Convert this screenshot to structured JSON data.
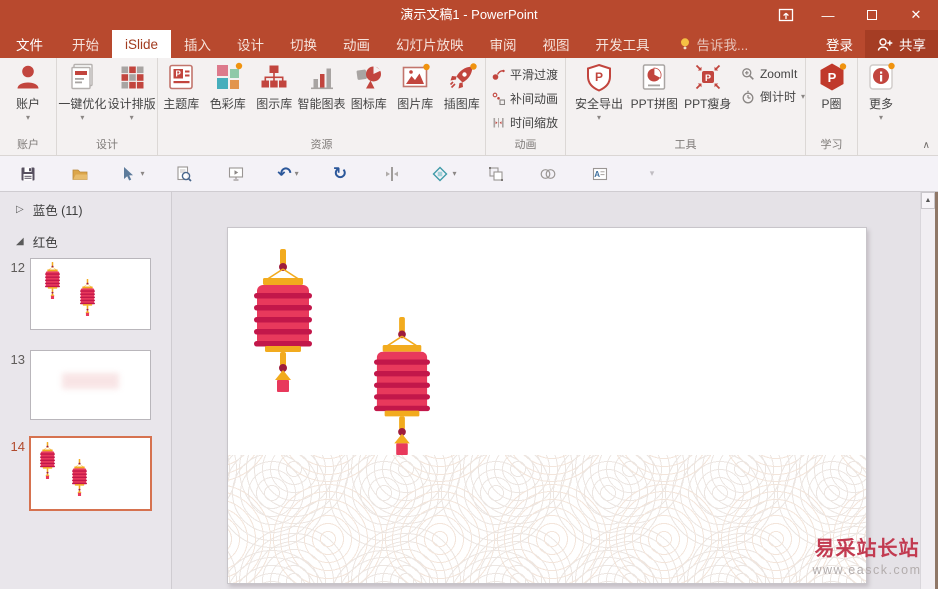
{
  "titlebar": {
    "title": "演示文稿1 - PowerPoint"
  },
  "tabs": {
    "file": "文件",
    "items": [
      "开始",
      "iSlide",
      "插入",
      "设计",
      "切换",
      "动画",
      "幻灯片放映",
      "审阅",
      "视图",
      "开发工具"
    ],
    "active": "iSlide",
    "tell_me": "告诉我...",
    "login": "登录",
    "share": "共享"
  },
  "ribbon": {
    "groups": [
      {
        "label": "账户"
      },
      {
        "label": "设计"
      },
      {
        "label": "资源"
      },
      {
        "label": "动画"
      },
      {
        "label": "工具"
      },
      {
        "label": "学习"
      }
    ],
    "buttons": {
      "account": "账户",
      "optimize": "一键优化",
      "layout": "设计排版",
      "theme": "主题库",
      "color": "色彩库",
      "diagram": "图示库",
      "smartchart": "智能图表",
      "iconlib": "图标库",
      "picture": "图片库",
      "illustration": "插图库",
      "smooth": "平滑过渡",
      "tween": "补间动画",
      "timescale": "时间缩放",
      "safeexport": "安全导出",
      "pptpuzzle": "PPT拼图",
      "pptslim": "PPT瘦身",
      "zoomit": "ZoomIt",
      "countdown": "倒计时",
      "pcircle": "P圈",
      "more": "更多"
    }
  },
  "qat": {
    "icons": [
      "save",
      "open",
      "apply-format",
      "print-preview",
      "start-slideshow",
      "undo",
      "redo",
      "align-objects",
      "shape-format",
      "group-objects",
      "merge-shapes",
      "text-box",
      "customize"
    ]
  },
  "panel": {
    "sections": [
      {
        "glyph": "▷",
        "label": "蓝色 (11)",
        "collapsed": true
      },
      {
        "glyph": "◢",
        "label": "红色",
        "collapsed": false
      }
    ],
    "slides": [
      {
        "number": "12",
        "selected": false
      },
      {
        "number": "13",
        "selected": false
      },
      {
        "number": "14",
        "selected": true
      }
    ]
  },
  "canvas": {
    "slide_objects": [
      "red-lantern",
      "red-lantern",
      "cloud-wave-pattern"
    ]
  },
  "watermark": {
    "brand": "易采站长站",
    "url": "www.easck.com"
  },
  "ui": {
    "caret": "▾",
    "collapse": "∧",
    "minimize": "—",
    "close": "✕",
    "scroll_up": "▲",
    "undo_glyph": "↶",
    "redo_glyph": "↻",
    "dash": "▾"
  },
  "colors": {
    "titlebar_red": "#b8492e",
    "tab_active_text": "#a23c20",
    "ribbon_bg": "#f4f1f1",
    "icon_red": "#c2453e",
    "accent_dot": "#f0930f",
    "lantern_pink": "#e8395c",
    "lantern_dark": "#c2174a",
    "lantern_gold": "#f2ab1e",
    "lantern_bead": "#9e1c3c",
    "selected_slide_border": "#d6724f",
    "watermark_red": "#c23a50"
  }
}
